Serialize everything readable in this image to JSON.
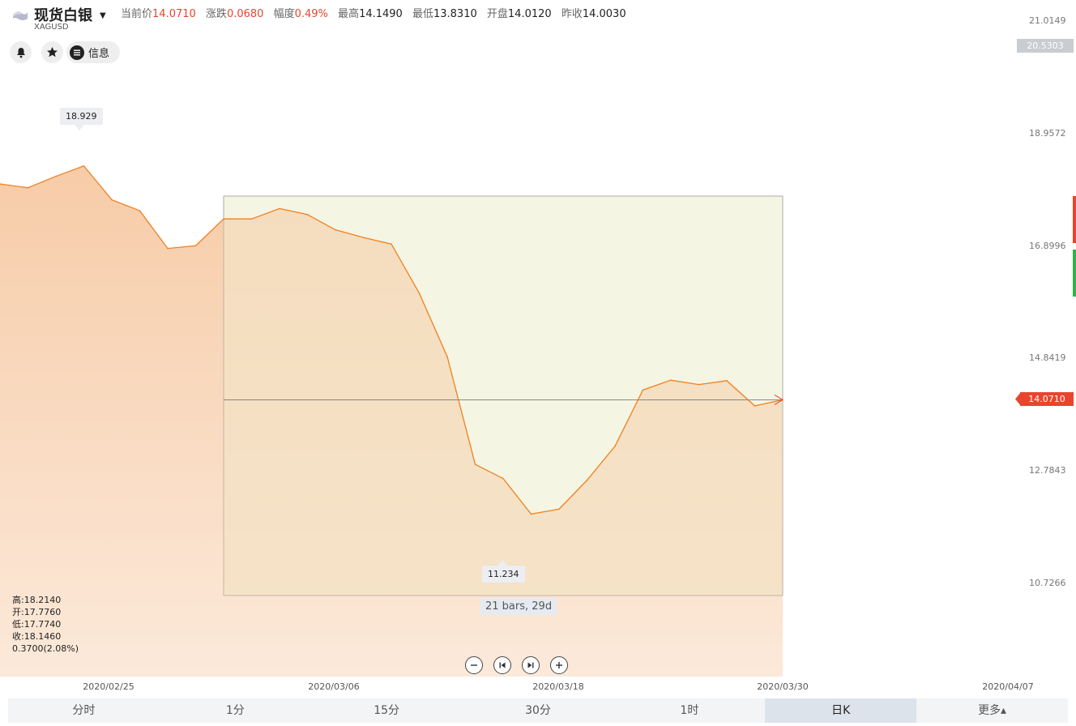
{
  "header": {
    "name": "现货白银",
    "symbol": "XAGUSD",
    "stats": [
      {
        "label": "当前价",
        "value": "14.0710",
        "color": "red"
      },
      {
        "label": "涨跌",
        "value": "0.0680",
        "color": "red"
      },
      {
        "label": "幅度",
        "value": "0.49%",
        "color": "red"
      },
      {
        "label": "最高",
        "value": "14.1490",
        "color": "black"
      },
      {
        "label": "最低",
        "value": "13.8310",
        "color": "black"
      },
      {
        "label": "开盘",
        "value": "14.0120",
        "color": "black"
      },
      {
        "label": "昨收",
        "value": "14.0030",
        "color": "black"
      }
    ]
  },
  "toolbar": {
    "bell_icon": "bell-icon",
    "star_icon": "star-icon",
    "info_icon": "menu-list-icon",
    "info_label": "信息"
  },
  "ohlc": {
    "high": "高:18.2140",
    "open": "开:17.7760",
    "low": "低:17.7740",
    "close": "收:18.1460",
    "change": "0.3700(2.08%)"
  },
  "tooltips": {
    "max": "18.929",
    "min": "11.234",
    "range": "21 bars, 29d"
  },
  "price_boxes": {
    "top": "20.5303",
    "current": "14.0710"
  },
  "tabs": [
    "分时",
    "1分",
    "15分",
    "30分",
    "1时",
    "日K",
    "更多▴"
  ],
  "active_tab": 5,
  "colors": {
    "line": "#f08020",
    "red": "#e8452f",
    "green": "#2fb34a",
    "range_fill": "#f2f1d9",
    "area_fill": "#f6c79f"
  },
  "chart_data": {
    "type": "area",
    "y_ticks": [
      "21.0149",
      "18.9572",
      "16.8996",
      "14.8419",
      "12.7843",
      "10.7266"
    ],
    "x_ticks": [
      "2020/02/25",
      "2020/03/06",
      "2020/03/18",
      "2020/03/30",
      "2020/04/07"
    ],
    "ylim": [
      10.7266,
      21.0149
    ],
    "series": [
      {
        "values": [
          18.02,
          17.95,
          18.16,
          18.35,
          17.73,
          17.53,
          16.84,
          16.89,
          17.38,
          17.38,
          17.57,
          17.46,
          17.18,
          17.04,
          16.92,
          16.02,
          14.86,
          12.89,
          12.63,
          11.98,
          12.07,
          12.6,
          13.22,
          14.25,
          14.43,
          14.35,
          14.42,
          13.96,
          14.07
        ]
      }
    ],
    "range": {
      "bars": 21,
      "days": 29
    }
  }
}
